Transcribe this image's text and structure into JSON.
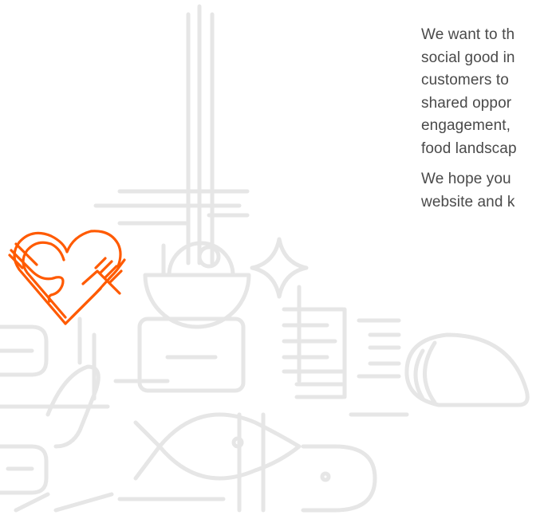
{
  "content": {
    "paragraph_1": [
      "We want to th",
      "social good in",
      "customers to",
      "shared oppor",
      "engagement,",
      "food landscap"
    ],
    "paragraph_2": [
      "We hope you",
      "website and k"
    ]
  },
  "logo": {
    "name": "heart-fork-hands-logo",
    "color": "#ff5a00"
  },
  "colors": {
    "background": "#ffffff",
    "text": "#4a4a4a",
    "line_art": "#e6e6e6",
    "accent": "#ff5a00"
  }
}
